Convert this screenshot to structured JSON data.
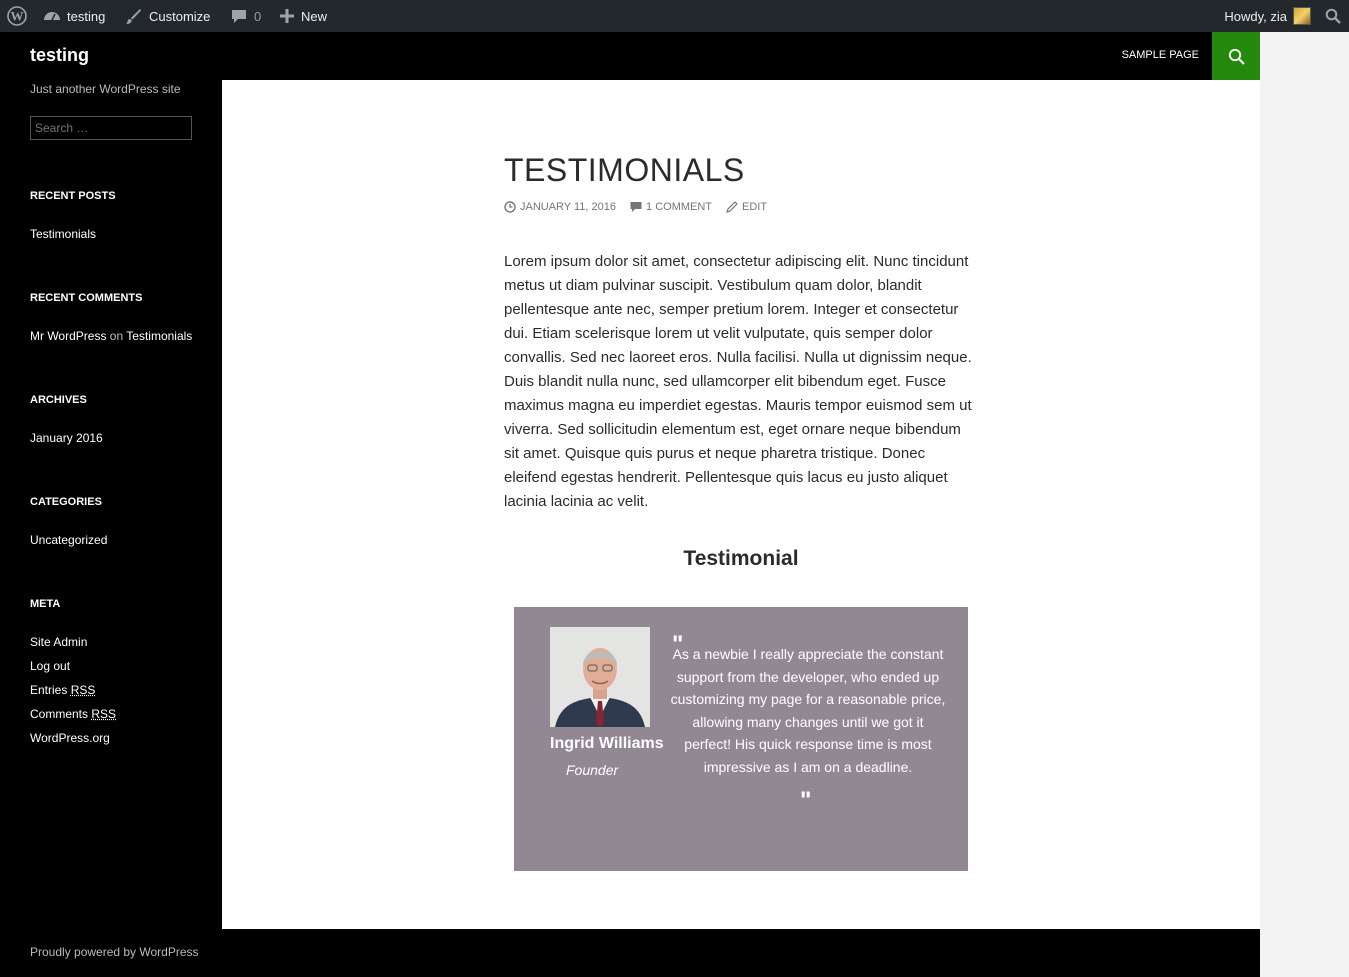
{
  "admin_bar": {
    "site_name": "testing",
    "customize": "Customize",
    "comments_count": "0",
    "new": "New",
    "howdy": "Howdy, zia"
  },
  "sidebar": {
    "site_title": "testing",
    "site_description": "Just another WordPress site",
    "search_placeholder": "Search …",
    "recent_posts_title": "RECENT POSTS",
    "recent_posts": [
      "Testimonials"
    ],
    "recent_comments_title": "RECENT COMMENTS",
    "recent_comment": {
      "author": "Mr WordPress",
      "on": "on",
      "post": "Testimonials"
    },
    "archives_title": "ARCHIVES",
    "archives": [
      "January 2016"
    ],
    "categories_title": "CATEGORIES",
    "categories": [
      "Uncategorized"
    ],
    "meta_title": "META",
    "meta": {
      "site_admin": "Site Admin",
      "log_out": "Log out",
      "entries_prefix": "Entries",
      "comments_prefix": "Comments",
      "rss": "RSS",
      "wordpress_org": "WordPress.org"
    }
  },
  "header": {
    "nav_sample_page": "SAMPLE PAGE"
  },
  "post": {
    "title": "TESTIMONIALS",
    "date": "JANUARY 11, 2016",
    "comments": "1 COMMENT",
    "edit": "EDIT",
    "body": "Lorem ipsum dolor sit amet, consectetur adipiscing elit. Nunc tincidunt metus ut diam pulvinar suscipit. Vestibulum quam dolor, blandit pellentesque ante nec, semper pretium lorem. Integer et consectetur dui. Etiam scelerisque lorem ut velit vulputate, quis semper dolor convallis. Sed nec laoreet eros. Nulla facilisi. Nulla ut dignissim neque. Duis blandit nulla nunc, sed ullamcorper elit bibendum eget. Fusce maximus magna eu imperdiet egestas. Mauris tempor euismod sem ut viverra. Sed sollicitudin elementum est, eget ornare neque bibendum sit amet. Quisque quis purus et neque pharetra tristique. Donec eleifend egestas hendrerit. Pellentesque quis lacus eu justo aliquet lacinia lacinia ac velit.",
    "testimonial_heading": "Testimonial",
    "testimonial": {
      "name": "Ingrid Williams",
      "role": "Founder",
      "quote": "As a newbie I really appreciate the constant support from the developer, who ended up customizing my page for a reasonable price, allowing many changes until we got it perfect! His quick response time is most impressive as I am on a deadline.",
      "box_color": "#918893"
    }
  },
  "footer": {
    "text": "Proudly powered by WordPress"
  },
  "colors": {
    "accent_green": "#24890d",
    "admin_bar_bg": "#23282d"
  }
}
